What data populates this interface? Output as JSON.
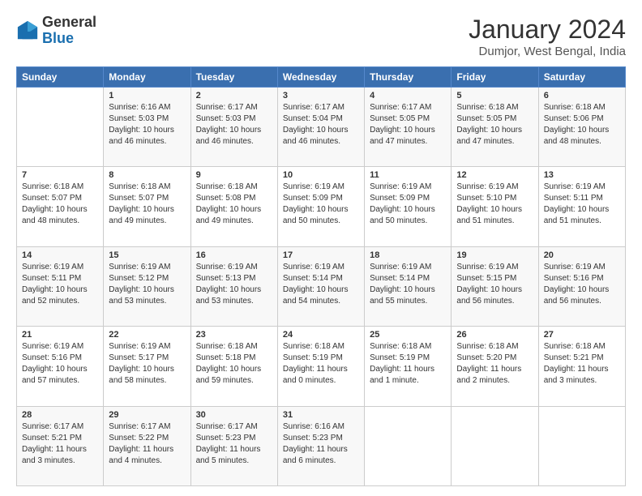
{
  "logo": {
    "general": "General",
    "blue": "Blue"
  },
  "title": "January 2024",
  "subtitle": "Dumjor, West Bengal, India",
  "days_of_week": [
    "Sunday",
    "Monday",
    "Tuesday",
    "Wednesday",
    "Thursday",
    "Friday",
    "Saturday"
  ],
  "weeks": [
    [
      {
        "day": "",
        "info": ""
      },
      {
        "day": "1",
        "info": "Sunrise: 6:16 AM\nSunset: 5:03 PM\nDaylight: 10 hours\nand 46 minutes."
      },
      {
        "day": "2",
        "info": "Sunrise: 6:17 AM\nSunset: 5:03 PM\nDaylight: 10 hours\nand 46 minutes."
      },
      {
        "day": "3",
        "info": "Sunrise: 6:17 AM\nSunset: 5:04 PM\nDaylight: 10 hours\nand 46 minutes."
      },
      {
        "day": "4",
        "info": "Sunrise: 6:17 AM\nSunset: 5:05 PM\nDaylight: 10 hours\nand 47 minutes."
      },
      {
        "day": "5",
        "info": "Sunrise: 6:18 AM\nSunset: 5:05 PM\nDaylight: 10 hours\nand 47 minutes."
      },
      {
        "day": "6",
        "info": "Sunrise: 6:18 AM\nSunset: 5:06 PM\nDaylight: 10 hours\nand 48 minutes."
      }
    ],
    [
      {
        "day": "7",
        "info": "Sunrise: 6:18 AM\nSunset: 5:07 PM\nDaylight: 10 hours\nand 48 minutes."
      },
      {
        "day": "8",
        "info": "Sunrise: 6:18 AM\nSunset: 5:07 PM\nDaylight: 10 hours\nand 49 minutes."
      },
      {
        "day": "9",
        "info": "Sunrise: 6:18 AM\nSunset: 5:08 PM\nDaylight: 10 hours\nand 49 minutes."
      },
      {
        "day": "10",
        "info": "Sunrise: 6:19 AM\nSunset: 5:09 PM\nDaylight: 10 hours\nand 50 minutes."
      },
      {
        "day": "11",
        "info": "Sunrise: 6:19 AM\nSunset: 5:09 PM\nDaylight: 10 hours\nand 50 minutes."
      },
      {
        "day": "12",
        "info": "Sunrise: 6:19 AM\nSunset: 5:10 PM\nDaylight: 10 hours\nand 51 minutes."
      },
      {
        "day": "13",
        "info": "Sunrise: 6:19 AM\nSunset: 5:11 PM\nDaylight: 10 hours\nand 51 minutes."
      }
    ],
    [
      {
        "day": "14",
        "info": "Sunrise: 6:19 AM\nSunset: 5:11 PM\nDaylight: 10 hours\nand 52 minutes."
      },
      {
        "day": "15",
        "info": "Sunrise: 6:19 AM\nSunset: 5:12 PM\nDaylight: 10 hours\nand 53 minutes."
      },
      {
        "day": "16",
        "info": "Sunrise: 6:19 AM\nSunset: 5:13 PM\nDaylight: 10 hours\nand 53 minutes."
      },
      {
        "day": "17",
        "info": "Sunrise: 6:19 AM\nSunset: 5:14 PM\nDaylight: 10 hours\nand 54 minutes."
      },
      {
        "day": "18",
        "info": "Sunrise: 6:19 AM\nSunset: 5:14 PM\nDaylight: 10 hours\nand 55 minutes."
      },
      {
        "day": "19",
        "info": "Sunrise: 6:19 AM\nSunset: 5:15 PM\nDaylight: 10 hours\nand 56 minutes."
      },
      {
        "day": "20",
        "info": "Sunrise: 6:19 AM\nSunset: 5:16 PM\nDaylight: 10 hours\nand 56 minutes."
      }
    ],
    [
      {
        "day": "21",
        "info": "Sunrise: 6:19 AM\nSunset: 5:16 PM\nDaylight: 10 hours\nand 57 minutes."
      },
      {
        "day": "22",
        "info": "Sunrise: 6:19 AM\nSunset: 5:17 PM\nDaylight: 10 hours\nand 58 minutes."
      },
      {
        "day": "23",
        "info": "Sunrise: 6:18 AM\nSunset: 5:18 PM\nDaylight: 10 hours\nand 59 minutes."
      },
      {
        "day": "24",
        "info": "Sunrise: 6:18 AM\nSunset: 5:19 PM\nDaylight: 11 hours\nand 0 minutes."
      },
      {
        "day": "25",
        "info": "Sunrise: 6:18 AM\nSunset: 5:19 PM\nDaylight: 11 hours\nand 1 minute."
      },
      {
        "day": "26",
        "info": "Sunrise: 6:18 AM\nSunset: 5:20 PM\nDaylight: 11 hours\nand 2 minutes."
      },
      {
        "day": "27",
        "info": "Sunrise: 6:18 AM\nSunset: 5:21 PM\nDaylight: 11 hours\nand 3 minutes."
      }
    ],
    [
      {
        "day": "28",
        "info": "Sunrise: 6:17 AM\nSunset: 5:21 PM\nDaylight: 11 hours\nand 3 minutes."
      },
      {
        "day": "29",
        "info": "Sunrise: 6:17 AM\nSunset: 5:22 PM\nDaylight: 11 hours\nand 4 minutes."
      },
      {
        "day": "30",
        "info": "Sunrise: 6:17 AM\nSunset: 5:23 PM\nDaylight: 11 hours\nand 5 minutes."
      },
      {
        "day": "31",
        "info": "Sunrise: 6:16 AM\nSunset: 5:23 PM\nDaylight: 11 hours\nand 6 minutes."
      },
      {
        "day": "",
        "info": ""
      },
      {
        "day": "",
        "info": ""
      },
      {
        "day": "",
        "info": ""
      }
    ]
  ]
}
